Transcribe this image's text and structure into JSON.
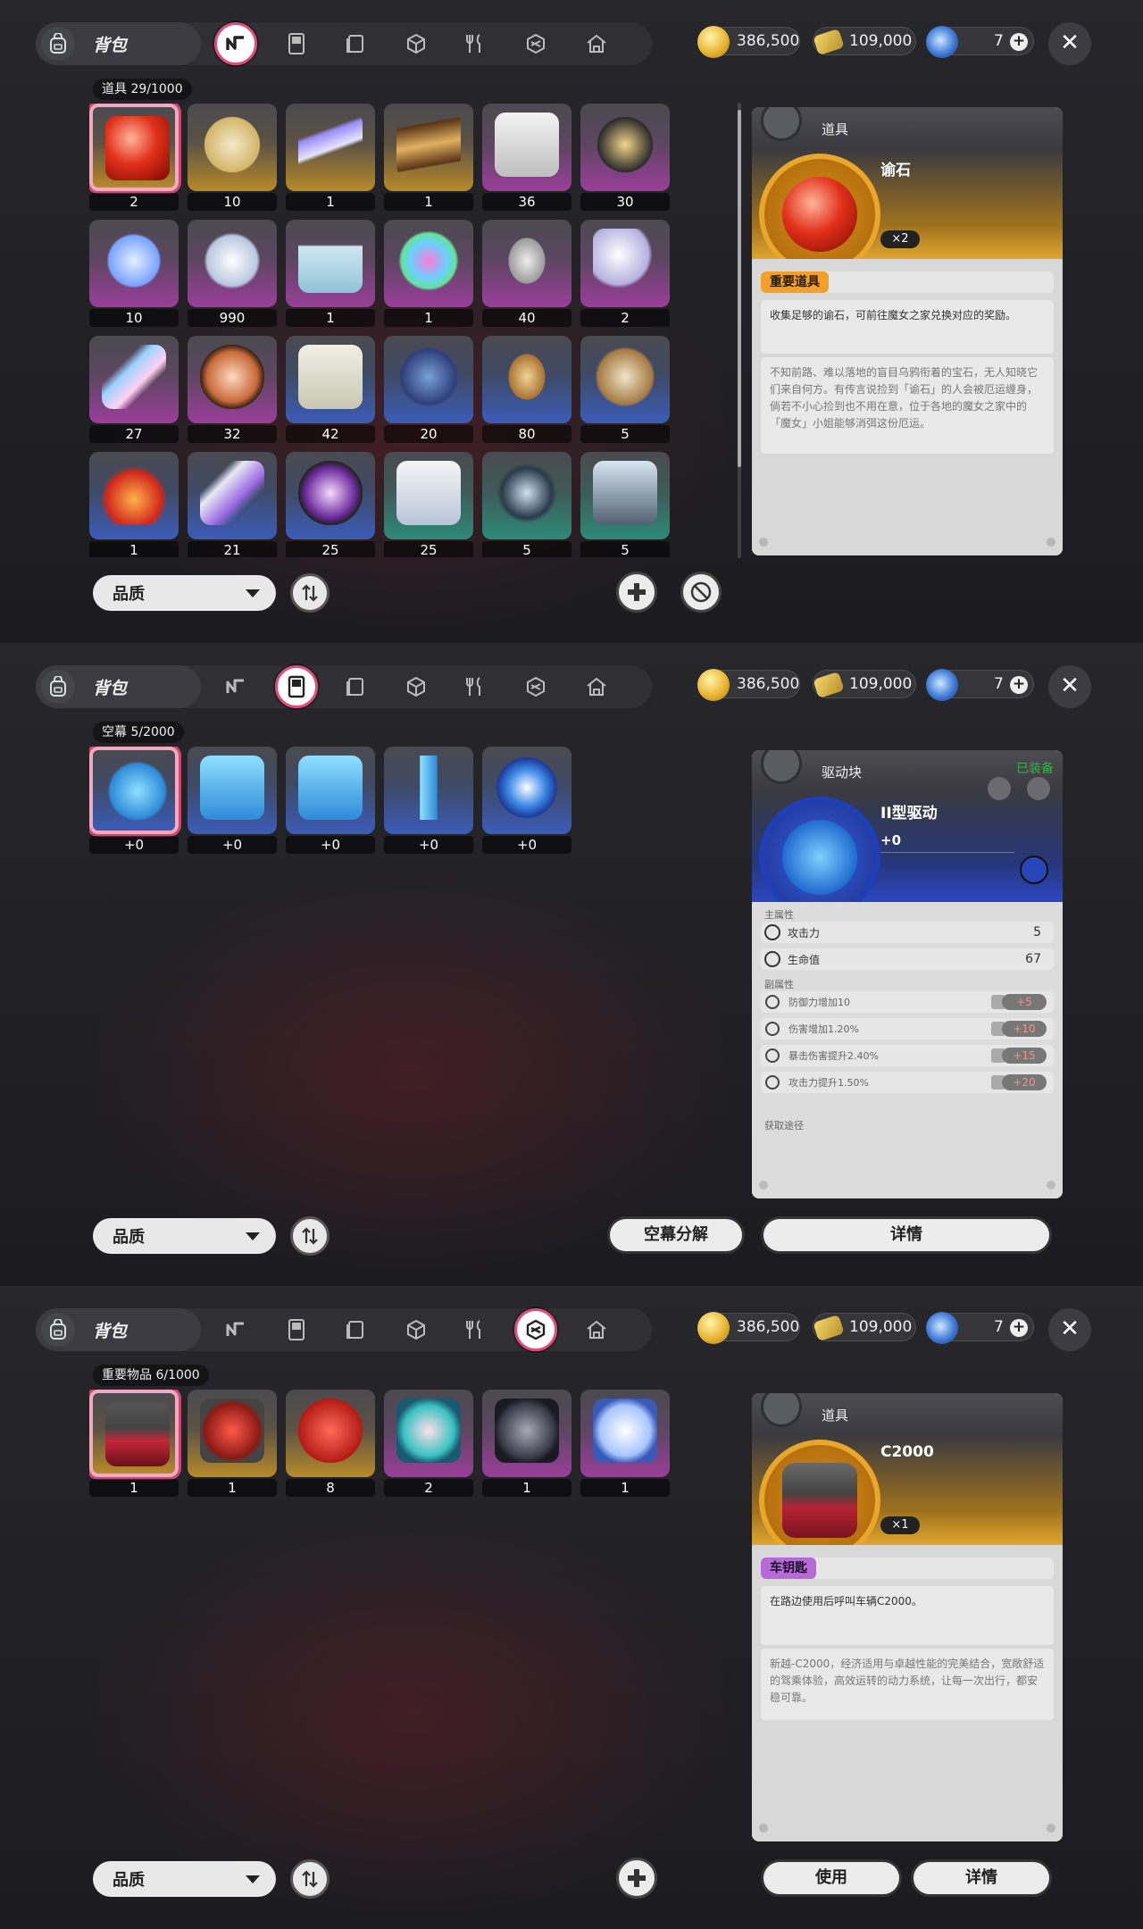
{
  "panels": [
    {
      "bag_label": "背包",
      "active_tab": 0,
      "currency": {
        "gold": "386,500",
        "ticket": "109,000",
        "gem": "7"
      },
      "count_label": "道具 29/1000",
      "items": [
        {
          "count": "2",
          "quality": "gold",
          "icon": "red-orb"
        },
        {
          "count": "10",
          "quality": "gold",
          "icon": "chess-piece"
        },
        {
          "count": "1",
          "quality": "gold",
          "icon": "hoverboard"
        },
        {
          "count": "1",
          "quality": "gold",
          "icon": "chocolate-bar"
        },
        {
          "count": "36",
          "quality": "purple",
          "icon": "cards"
        },
        {
          "count": "30",
          "quality": "purple",
          "icon": "mirror-frame"
        },
        {
          "count": "10",
          "quality": "purple",
          "icon": "crystals"
        },
        {
          "count": "990",
          "quality": "purple",
          "icon": "crystal-cluster"
        },
        {
          "count": "1",
          "quality": "purple",
          "icon": "potion-bottle"
        },
        {
          "count": "1",
          "quality": "purple",
          "icon": "paint-can"
        },
        {
          "count": "40",
          "quality": "purple",
          "icon": "silver-coin"
        },
        {
          "count": "2",
          "quality": "purple",
          "icon": "seashell"
        },
        {
          "count": "27",
          "quality": "purple",
          "icon": "star-rod"
        },
        {
          "count": "32",
          "quality": "purple",
          "icon": "bunny-badge"
        },
        {
          "count": "42",
          "quality": "blue",
          "icon": "certificate"
        },
        {
          "count": "20",
          "quality": "blue",
          "icon": "ghost"
        },
        {
          "count": "80",
          "quality": "blue",
          "icon": "bronze-coin"
        },
        {
          "count": "5",
          "quality": "blue",
          "icon": "cookie-bag"
        },
        {
          "count": "1",
          "quality": "blue",
          "icon": "rooster"
        },
        {
          "count": "21",
          "quality": "blue",
          "icon": "paint-tube"
        },
        {
          "count": "25",
          "quality": "blue",
          "icon": "rabbit-badge"
        },
        {
          "count": "25",
          "quality": "teal",
          "icon": "magazine"
        },
        {
          "count": "5",
          "quality": "teal",
          "icon": "smartwatch"
        },
        {
          "count": "5",
          "quality": "teal",
          "icon": "photo-frame"
        }
      ],
      "filter_label": "品质",
      "detail": {
        "category": "道具",
        "name": "谕石",
        "qty": "×2",
        "tag": "重要道具",
        "desc": "收集足够的谕石，可前往魔女之家兑换对应的奖励。",
        "flavor": "不知前路、难以落地的盲目乌鸦衔着的宝石，无人知晓它们来自何方。有传言说捡到「谕石」的人会被厄运缠身，倘若不小心捡到也不用在意，位于各地的魔女之家中的「魔女」小姐能够消弭这份厄运。"
      }
    },
    {
      "bag_label": "背包",
      "active_tab": 1,
      "currency": {
        "gold": "386,500",
        "ticket": "109,000",
        "gem": "7"
      },
      "count_label": "空幕 5/2000",
      "items": [
        {
          "count": "+0",
          "quality": "blue",
          "icon": "drive-block-ii"
        },
        {
          "count": "+0",
          "quality": "blue",
          "icon": "drive-block-l"
        },
        {
          "count": "+0",
          "quality": "blue",
          "icon": "drive-block-j"
        },
        {
          "count": "+0",
          "quality": "blue",
          "icon": "drive-block-i"
        },
        {
          "count": "+0",
          "quality": "blue",
          "icon": "drive-core"
        }
      ],
      "filter_label": "品质",
      "decompose_label": "空幕分解",
      "details_label": "详情",
      "detail": {
        "category": "驱动块",
        "equipped": "已装备",
        "name": "II型驱动",
        "level": "+0",
        "main_label": "主属性",
        "main_stats": [
          {
            "name": "攻击力",
            "value": "5"
          },
          {
            "name": "生命值",
            "value": "67"
          }
        ],
        "sub_label": "副属性",
        "sub_stats": [
          {
            "name": "防御力增加10",
            "bonus": "+5"
          },
          {
            "name": "伤害增加1.20%",
            "bonus": "+10"
          },
          {
            "name": "暴击伤害提升2.40%",
            "bonus": "+15"
          },
          {
            "name": "攻击力提升1.50%",
            "bonus": "+20"
          }
        ],
        "source_label": "获取途径"
      }
    },
    {
      "bag_label": "背包",
      "active_tab": 5,
      "currency": {
        "gold": "386,500",
        "ticket": "109,000",
        "gem": "7"
      },
      "count_label": "重要物品 6/1000",
      "items": [
        {
          "count": "1",
          "quality": "gold",
          "icon": "red-car"
        },
        {
          "count": "1",
          "quality": "gold",
          "icon": "red-scooter"
        },
        {
          "count": "8",
          "quality": "gold",
          "icon": "red-dice"
        },
        {
          "count": "2",
          "quality": "purple",
          "icon": "portrait-cyan-hair"
        },
        {
          "count": "1",
          "quality": "purple",
          "icon": "portrait-wolf"
        },
        {
          "count": "1",
          "quality": "purple",
          "icon": "portrait-blue-hair"
        }
      ],
      "filter_label": "品质",
      "use_label": "使用",
      "details_label": "详情",
      "detail": {
        "category": "道具",
        "name": "C2000",
        "qty": "×1",
        "tag": "车钥匙",
        "desc": "在路边使用后呼叫车辆C2000。",
        "flavor": "新越-C2000，经济适用与卓越性能的完美结合，宽敞舒适的驾乘体验，高效运转的动力系统，让每一次出行，都安稳可靠。"
      }
    }
  ]
}
